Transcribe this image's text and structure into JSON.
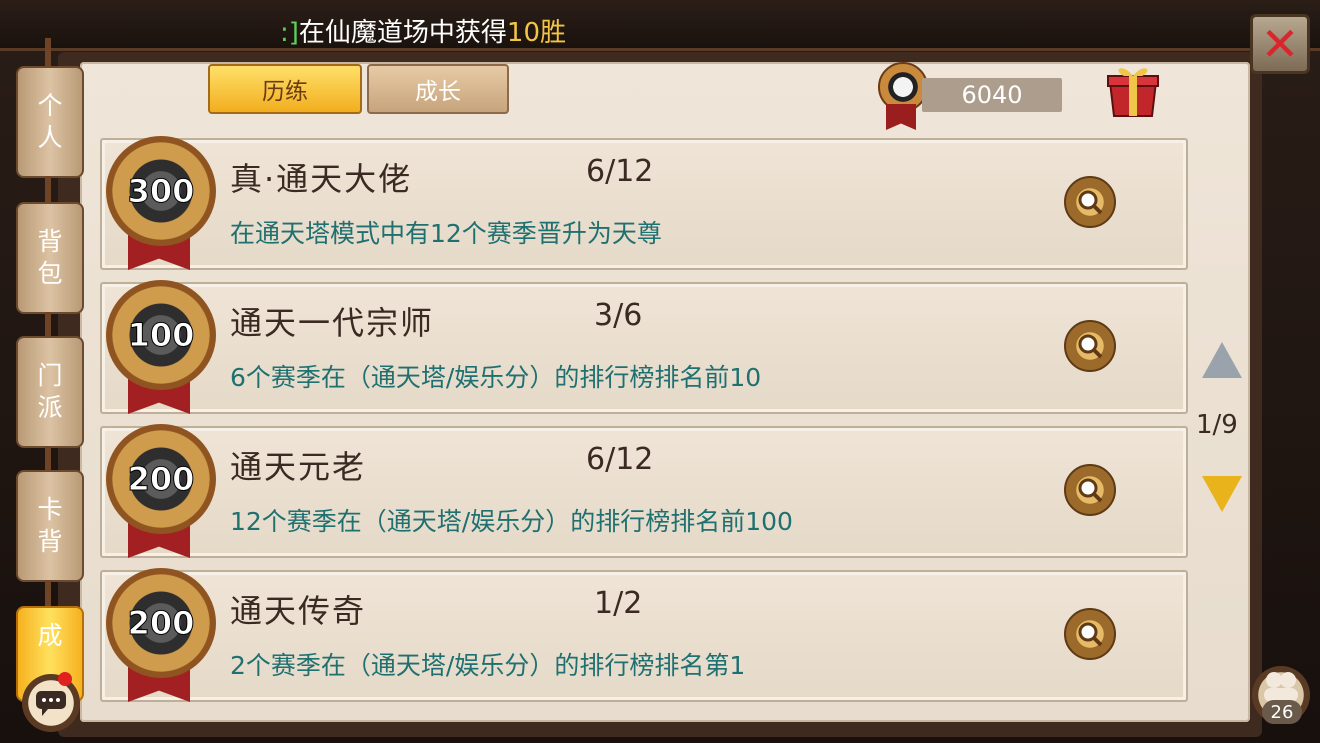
{
  "ticker": {
    "bracket": ":]",
    "text": "在仙魔道场中获得",
    "highlight": "10胜"
  },
  "tabs": [
    {
      "label": "历练"
    },
    {
      "label": "成长"
    }
  ],
  "currency": {
    "amount": "6040"
  },
  "side_tabs": [
    {
      "label": "个\n人"
    },
    {
      "label": "背\n包"
    },
    {
      "label": "门\n派"
    },
    {
      "label": "卡\n背"
    },
    {
      "label": "成"
    }
  ],
  "achievements": [
    {
      "points": "300",
      "title": "真·通天大佬",
      "progress": "6/12",
      "description": "在通天塔模式中有12个赛季晋升为天尊"
    },
    {
      "points": "100",
      "title": "通天一代宗师",
      "progress": "3/6",
      "description": "6个赛季在（通天塔/娱乐分）的排行榜排名前10"
    },
    {
      "points": "200",
      "title": "通天元老",
      "progress": "6/12",
      "description": "12个赛季在（通天塔/娱乐分）的排行榜排名前100"
    },
    {
      "points": "200",
      "title": "通天传奇",
      "progress": "1/2",
      "description": "2个赛季在（通天塔/娱乐分）的排行榜排名第1"
    }
  ],
  "pagination": {
    "indicator": "1/9"
  },
  "friends": {
    "count": "26"
  },
  "icons": {
    "close": "close-icon",
    "search": "magnifier-icon",
    "gift": "gift-box-icon",
    "currency": "yin-yang-medal-icon",
    "chat": "chat-bubble-icon",
    "friends": "friends-icon"
  },
  "colors": {
    "tab_active": "#f2ae1e",
    "description_text": "#1f7070",
    "ribbon": "#a21f22",
    "close": "#d8262a"
  }
}
